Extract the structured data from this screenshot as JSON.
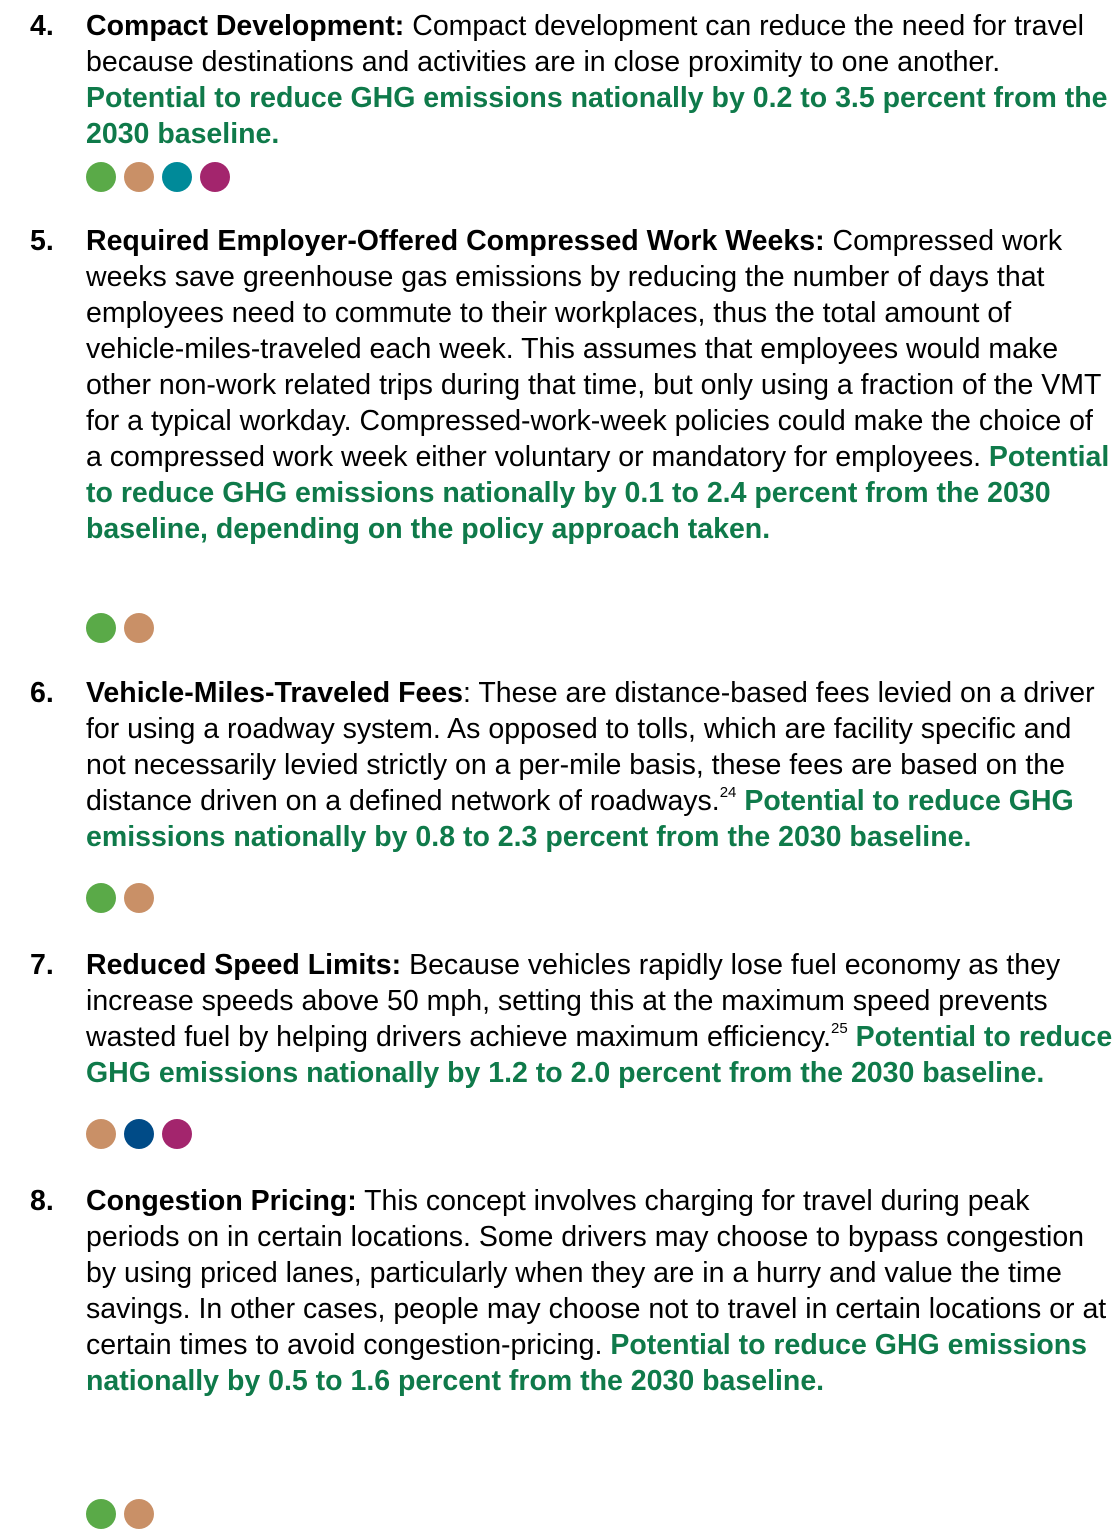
{
  "colors": {
    "potential_text": "#0f7a4a",
    "dot_green": "#5aaa48",
    "dot_tan": "#c99067",
    "dot_teal": "#008a99",
    "dot_magenta": "#a3256d",
    "dot_navy": "#004b87"
  },
  "items": [
    {
      "number": "4.",
      "title": "Compact Development:",
      "text": " Compact development can reduce the need for travel because destinations and activities are in close proximity to one another. ",
      "potential": "Potential to reduce GHG emissions nationally by 0.2 to 3.5 percent from the 2030 baseline.",
      "dots": [
        "green",
        "tan",
        "teal",
        "magenta"
      ]
    },
    {
      "number": "5.",
      "title": "Required Employer-Offered Compressed Work Weeks:",
      "text": " Compressed work weeks save greenhouse gas emissions by reducing the number of days that employees need to commute to their workplaces, thus the total amount of vehicle-miles-traveled each week. This assumes that employees would make other non-work related trips during that time, but only using a fraction of the VMT for a typical workday. Compressed-work-week policies could make the choice of a compressed work week either voluntary or mandatory for employees. ",
      "potential": "Potential to reduce GHG emissions nationally by 0.1 to 2.4 percent from the 2030 baseline, depending on the policy approach taken.",
      "dots": [
        "green",
        "tan"
      ]
    },
    {
      "number": "6.",
      "title": "Vehicle-Miles-Traveled Fees",
      "text": ": These are distance-based fees levied on a driver for using a roadway system. As opposed to tolls, which are facility specific and not necessarily levied strictly on a per-mile basis, these fees are based on the distance driven on a defined network of roadways.",
      "footnote": "24",
      "potential": "Potential to reduce GHG emissions nationally by 0.8 to 2.3 percent from the 2030 baseline.",
      "dots": [
        "green",
        "tan"
      ]
    },
    {
      "number": "7.",
      "title": "Reduced Speed Limits:",
      "text": " Because vehicles rapidly lose fuel economy as they increase speeds above 50 mph, setting this at the maximum speed prevents wasted fuel by helping drivers achieve maximum efficiency.",
      "footnote": "25",
      "potential": "Potential to reduce GHG emissions nationally by 1.2 to 2.0 percent from the 2030 baseline.",
      "dots": [
        "tan",
        "navy",
        "magenta"
      ]
    },
    {
      "number": "8.",
      "title": "Congestion Pricing:",
      "text": " This concept involves charging for travel during peak periods on in certain locations. Some drivers may choose to bypass congestion by using priced lanes, particularly when they are in a hurry and value the time savings. In other cases, people may choose not to travel in certain locations or at certain times to avoid congestion-pricing.  ",
      "potential": "Potential to reduce GHG emissions nationally by 0.5 to 1.6 percent from the 2030 baseline.",
      "dots": [
        "green",
        "tan"
      ]
    }
  ]
}
